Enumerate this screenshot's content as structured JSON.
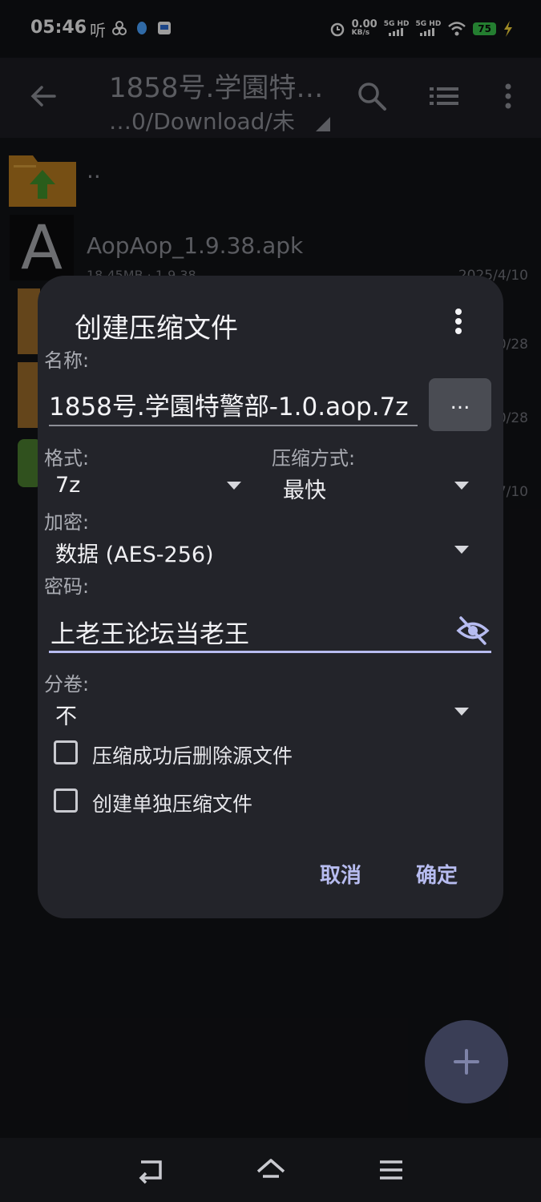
{
  "status_bar": {
    "time": "05:46",
    "extra_icon_text": "听",
    "net_speed_value": "0.00",
    "net_speed_unit": "KB/s",
    "signal1": "5G HD",
    "signal2": "5G HD",
    "battery": "75"
  },
  "app_bar": {
    "title": "1858号.学園特…",
    "subtitle": "…0/Download/未"
  },
  "files": [
    {
      "name": "..",
      "meta": "",
      "date": ""
    },
    {
      "name": "AopAop_1.9.38.apk",
      "meta": "18.45MB  · 1.9.38",
      "date": "2025/4/10"
    },
    {
      "name": "",
      "meta": "",
      "date": "0/28"
    },
    {
      "name": "",
      "meta": "",
      "date": "0/28"
    },
    {
      "name": "",
      "meta": "",
      "date": "7/10"
    }
  ],
  "dialog": {
    "title": "创建压缩文件",
    "name_label": "名称:",
    "name_value": "1858号.学園特警部-1.0.aop.7z",
    "browse_label": "...",
    "format_label": "格式:",
    "format_value": "7z",
    "method_label": "压缩方式:",
    "method_value": "最快",
    "encryption_label": "加密:",
    "encryption_value": "数据 (AES-256)",
    "password_label": "密码:",
    "password_value": "上老王论坛当老王",
    "split_label": "分卷:",
    "split_value": "不",
    "delete_source_label": "压缩成功后删除源文件",
    "separate_archives_label": "创建单独压缩文件",
    "cancel_label": "取消",
    "ok_label": "确定"
  },
  "colors": {
    "accent": "#b7bcf0",
    "dialog_bg": "#23242a",
    "battery": "#38c24a"
  }
}
